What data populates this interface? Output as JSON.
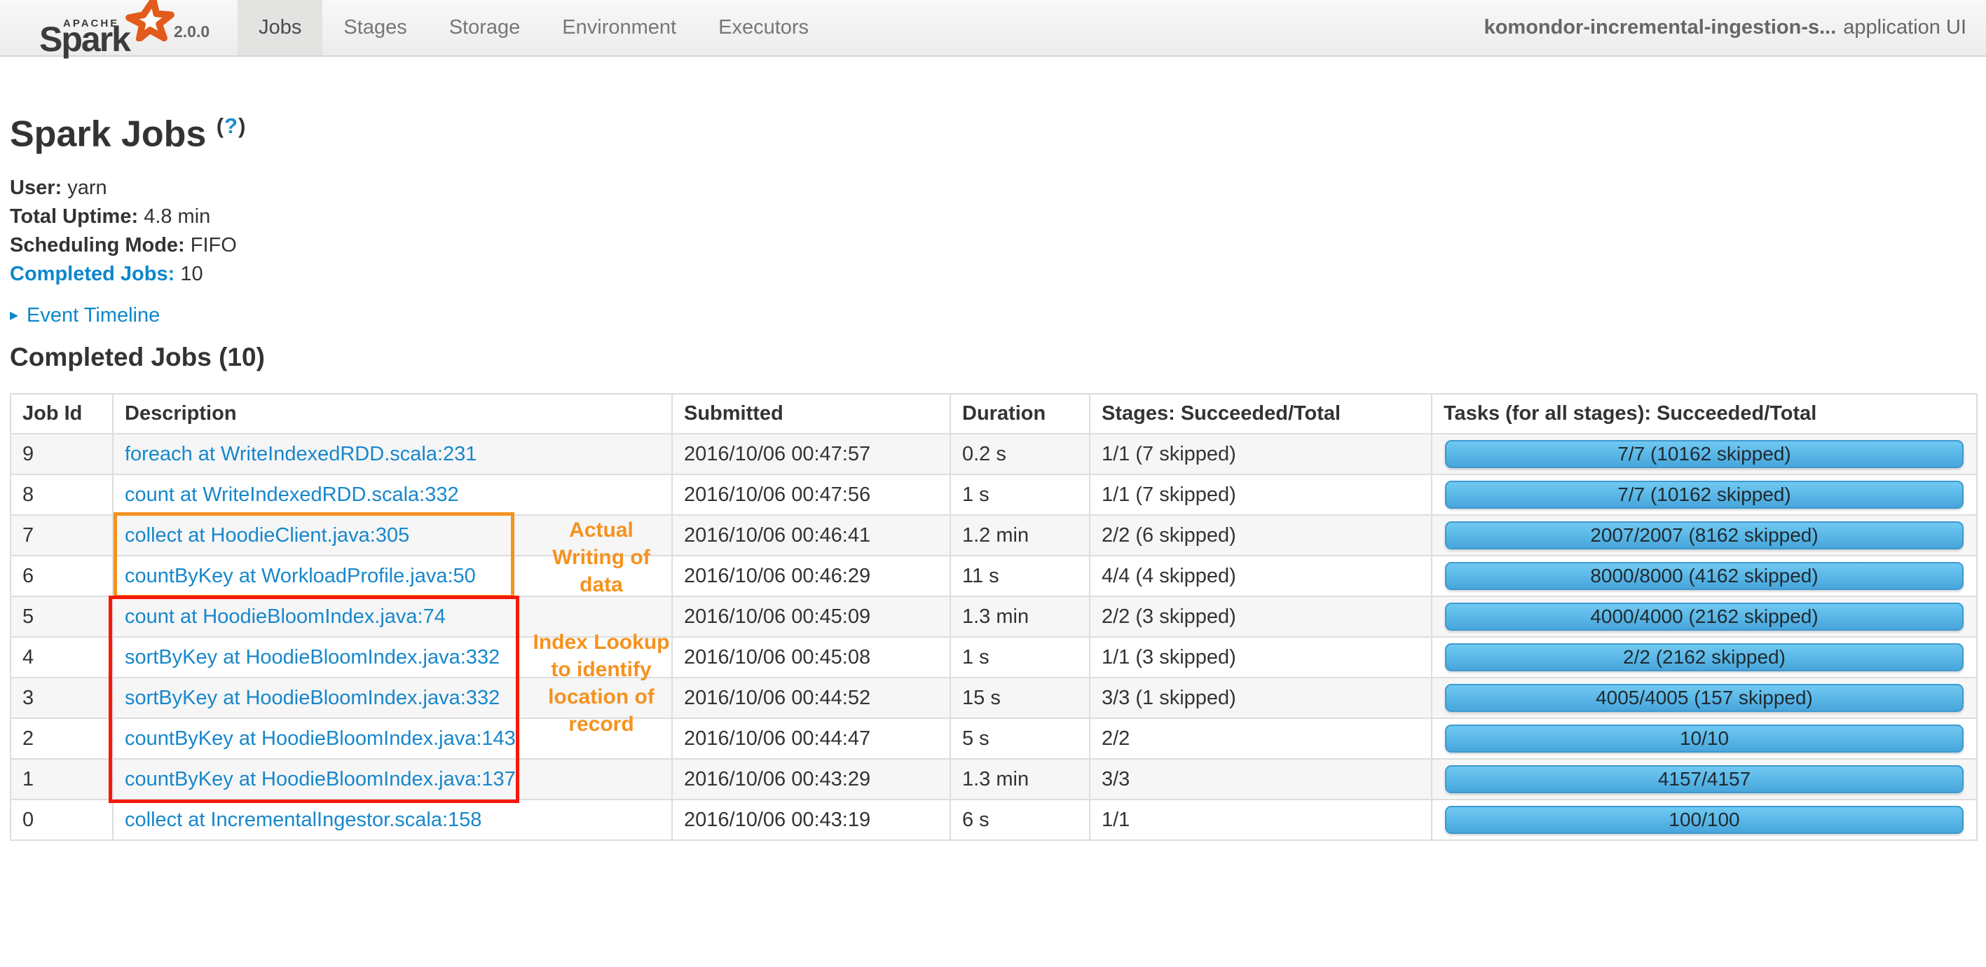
{
  "navbar": {
    "logo": {
      "apache": "APACHE",
      "name": "Spark",
      "version": "2.0.0"
    },
    "tabs": [
      {
        "label": "Jobs",
        "active": true
      },
      {
        "label": "Stages",
        "active": false
      },
      {
        "label": "Storage",
        "active": false
      },
      {
        "label": "Environment",
        "active": false
      },
      {
        "label": "Executors",
        "active": false
      }
    ],
    "app_name": "komondor-incremental-ingestion-s...",
    "app_suffix": "application UI"
  },
  "header": {
    "title": "Spark Jobs",
    "help_open_paren": "(",
    "help_q": "?",
    "help_close_paren": ")"
  },
  "summary": {
    "user_label": "User:",
    "user_value": "yarn",
    "uptime_label": "Total Uptime:",
    "uptime_value": "4.8 min",
    "scheduling_label": "Scheduling Mode:",
    "scheduling_value": "FIFO",
    "completed_label": "Completed Jobs:",
    "completed_value": "10"
  },
  "event_timeline": {
    "arrow": "▸",
    "label": "Event Timeline"
  },
  "section": {
    "title": "Completed Jobs (10)"
  },
  "table": {
    "columns": [
      "Job Id",
      "Description",
      "Submitted",
      "Duration",
      "Stages: Succeeded/Total",
      "Tasks (for all stages): Succeeded/Total"
    ],
    "rows": [
      {
        "id": "9",
        "description": "foreach at WriteIndexedRDD.scala:231",
        "submitted": "2016/10/06 00:47:57",
        "duration": "0.2 s",
        "stages": "1/1 (7 skipped)",
        "tasks": "7/7 (10162 skipped)"
      },
      {
        "id": "8",
        "description": "count at WriteIndexedRDD.scala:332",
        "submitted": "2016/10/06 00:47:56",
        "duration": "1 s",
        "stages": "1/1 (7 skipped)",
        "tasks": "7/7 (10162 skipped)"
      },
      {
        "id": "7",
        "description": "collect at HoodieClient.java:305",
        "submitted": "2016/10/06 00:46:41",
        "duration": "1.2 min",
        "stages": "2/2 (6 skipped)",
        "tasks": "2007/2007 (8162 skipped)"
      },
      {
        "id": "6",
        "description": "countByKey at WorkloadProfile.java:50",
        "submitted": "2016/10/06 00:46:29",
        "duration": "11 s",
        "stages": "4/4 (4 skipped)",
        "tasks": "8000/8000 (4162 skipped)"
      },
      {
        "id": "5",
        "description": "count at HoodieBloomIndex.java:74",
        "submitted": "2016/10/06 00:45:09",
        "duration": "1.3 min",
        "stages": "2/2 (3 skipped)",
        "tasks": "4000/4000 (2162 skipped)"
      },
      {
        "id": "4",
        "description": "sortByKey at HoodieBloomIndex.java:332",
        "submitted": "2016/10/06 00:45:08",
        "duration": "1 s",
        "stages": "1/1 (3 skipped)",
        "tasks": "2/2 (2162 skipped)"
      },
      {
        "id": "3",
        "description": "sortByKey at HoodieBloomIndex.java:332",
        "submitted": "2016/10/06 00:44:52",
        "duration": "15 s",
        "stages": "3/3 (1 skipped)",
        "tasks": "4005/4005 (157 skipped)"
      },
      {
        "id": "2",
        "description": "countByKey at HoodieBloomIndex.java:143",
        "submitted": "2016/10/06 00:44:47",
        "duration": "5 s",
        "stages": "2/2",
        "tasks": "10/10"
      },
      {
        "id": "1",
        "description": "countByKey at HoodieBloomIndex.java:137",
        "submitted": "2016/10/06 00:43:29",
        "duration": "1.3 min",
        "stages": "3/3",
        "tasks": "4157/4157"
      },
      {
        "id": "0",
        "description": "collect at IncrementalIngestor.scala:158",
        "submitted": "2016/10/06 00:43:19",
        "duration": "6 s",
        "stages": "1/1",
        "tasks": "100/100"
      }
    ]
  },
  "annotations": {
    "writing": {
      "lines": [
        "Actual",
        "Writing of",
        "data"
      ],
      "text_color": "#f5921e",
      "box_color": "#f5921e"
    },
    "index_lookup": {
      "lines": [
        "Index Lookup",
        "to identify",
        "location of",
        "record"
      ],
      "text_color": "#f5921e",
      "box_color": "#f5190a"
    }
  },
  "colors": {
    "link_blue": "#1787cb",
    "progress_top": "#70c9f2",
    "progress_bottom": "#47a6dc",
    "progress_border": "#3d9ad1",
    "annotation_orange": "#f5921e",
    "annotation_red": "#f5190a",
    "spark_logo_orange": "#e25a1c",
    "active_tab_bg": "#e3e3e2"
  }
}
